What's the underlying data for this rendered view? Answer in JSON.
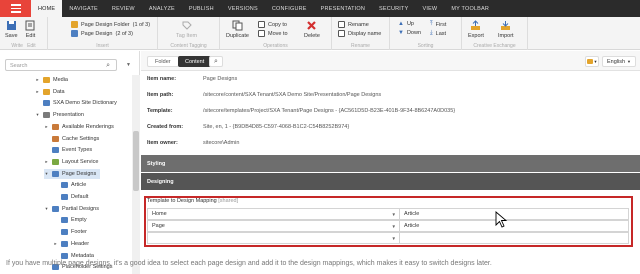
{
  "topbar": {
    "tabs": [
      {
        "label": "HOME",
        "active": true
      },
      {
        "label": "NAVIGATE",
        "active": false
      },
      {
        "label": "REVIEW",
        "active": false
      },
      {
        "label": "ANALYZE",
        "active": false
      },
      {
        "label": "PUBLISH",
        "active": false
      },
      {
        "label": "VERSIONS",
        "active": false
      },
      {
        "label": "CONFIGURE",
        "active": false
      },
      {
        "label": "PRESENTATION",
        "active": false
      },
      {
        "label": "SECURITY",
        "active": false
      },
      {
        "label": "VIEW",
        "active": false
      },
      {
        "label": "MY TOOLBAR",
        "active": false
      }
    ]
  },
  "ribbon": {
    "save_label": "Save",
    "edit_label": "Edit",
    "write_group": "Write",
    "edit_group": "Edit",
    "insert_1": "Page Design Folder",
    "insert_1_count": "(1 of 3)",
    "insert_2": "Page Design",
    "insert_2_count": "(2 of 3)",
    "insert_group": "Insert",
    "tagging_label": "Tag Item",
    "tagging_group": "Content Tagging",
    "duplicate_label": "Duplicate",
    "copy_to": "Copy to",
    "move_to": "Move to",
    "delete_label": "Delete",
    "operations_group": "Operations",
    "rename_label": "Rename",
    "display_name": "Display name",
    "rename_group": "Rename",
    "up_label": "Up",
    "down_label": "Down",
    "first_label": "First",
    "last_label": "Last",
    "sorting_group": "Sorting",
    "export_label": "Export",
    "import_label": "Import",
    "exchange_group": "Creative Exchange"
  },
  "left_panel": {
    "search_placeholder": "Search",
    "tree": [
      {
        "label": "Media",
        "indent": 3,
        "arrow": "▸",
        "icon_color": "#e3a42b"
      },
      {
        "label": "Data",
        "indent": 3,
        "arrow": "▸",
        "icon_color": "#e3a42b"
      },
      {
        "label": "SXA Demo Site Dictionary",
        "indent": 3,
        "arrow": "",
        "icon_color": "#4d7fc1"
      },
      {
        "label": "Presentation",
        "indent": 3,
        "arrow": "▾",
        "icon_color": "#7b7b7b"
      },
      {
        "label": "Available Renderings",
        "indent": 4,
        "arrow": "▸",
        "icon_color": "#c97a3a"
      },
      {
        "label": "Cache Settings",
        "indent": 4,
        "arrow": "",
        "icon_color": "#c97a3a"
      },
      {
        "label": "Event Types",
        "indent": 4,
        "arrow": "",
        "icon_color": "#4d7fc1"
      },
      {
        "label": "Layout Service",
        "indent": 4,
        "arrow": "▸",
        "icon_color": "#7aa842"
      },
      {
        "label": "Page Designs",
        "indent": 4,
        "arrow": "▾",
        "icon_color": "#4d7fc1",
        "selected": true
      },
      {
        "label": "Article",
        "indent": 5,
        "arrow": "",
        "icon_color": "#4d7fc1"
      },
      {
        "label": "Default",
        "indent": 5,
        "arrow": "",
        "icon_color": "#4d7fc1"
      },
      {
        "label": "Partial Designs",
        "indent": 4,
        "arrow": "▾",
        "icon_color": "#4d7fc1"
      },
      {
        "label": "Empty",
        "indent": 5,
        "arrow": "",
        "icon_color": "#4d7fc1"
      },
      {
        "label": "Footer",
        "indent": 5,
        "arrow": "",
        "icon_color": "#4d7fc1"
      },
      {
        "label": "Header",
        "indent": 5,
        "arrow": "▸",
        "icon_color": "#4d7fc1"
      },
      {
        "label": "Metadata",
        "indent": 5,
        "arrow": "",
        "icon_color": "#4d7fc1"
      },
      {
        "label": "Placeholder Settings",
        "indent": 4,
        "arrow": "",
        "icon_color": "#4d7fc1"
      }
    ]
  },
  "editor": {
    "tab_folder": "Folder",
    "tab_content": "Content",
    "language_label": "English",
    "quick_info": [
      {
        "label": "Item name:",
        "value": "Page Designs"
      },
      {
        "label": "Item path:",
        "value": "/sitecore/content/SXA Tenant/SXA Demo Site/Presentation/Page Designs"
      },
      {
        "label": "Template:",
        "value": "/sitecore/templates/Project/SXA Tenant/Page Designs - {AC561D5D-B23E-401B-9F34-8B6247A0D035}"
      },
      {
        "label": "Created from:",
        "value": "Site, en, 1 - {B9DB4D85-C597-4068-B1C2-C54B8252B974}"
      },
      {
        "label": "Item owner:",
        "value": "sitecore\\Admin"
      }
    ],
    "section_styling": "Styling",
    "section_designing": "Designing",
    "field_label": "Template to Design Mapping",
    "field_shared": "[shared]",
    "mapping_rows": [
      {
        "template": "Home",
        "design": "Article"
      },
      {
        "template": "Page",
        "design": "Article"
      },
      {
        "template": "",
        "design": ""
      }
    ]
  },
  "caption": "If you have multiple page designs, it's a good idea to select each page design and add it to the design mappings, which makes it easy to switch designs later."
}
